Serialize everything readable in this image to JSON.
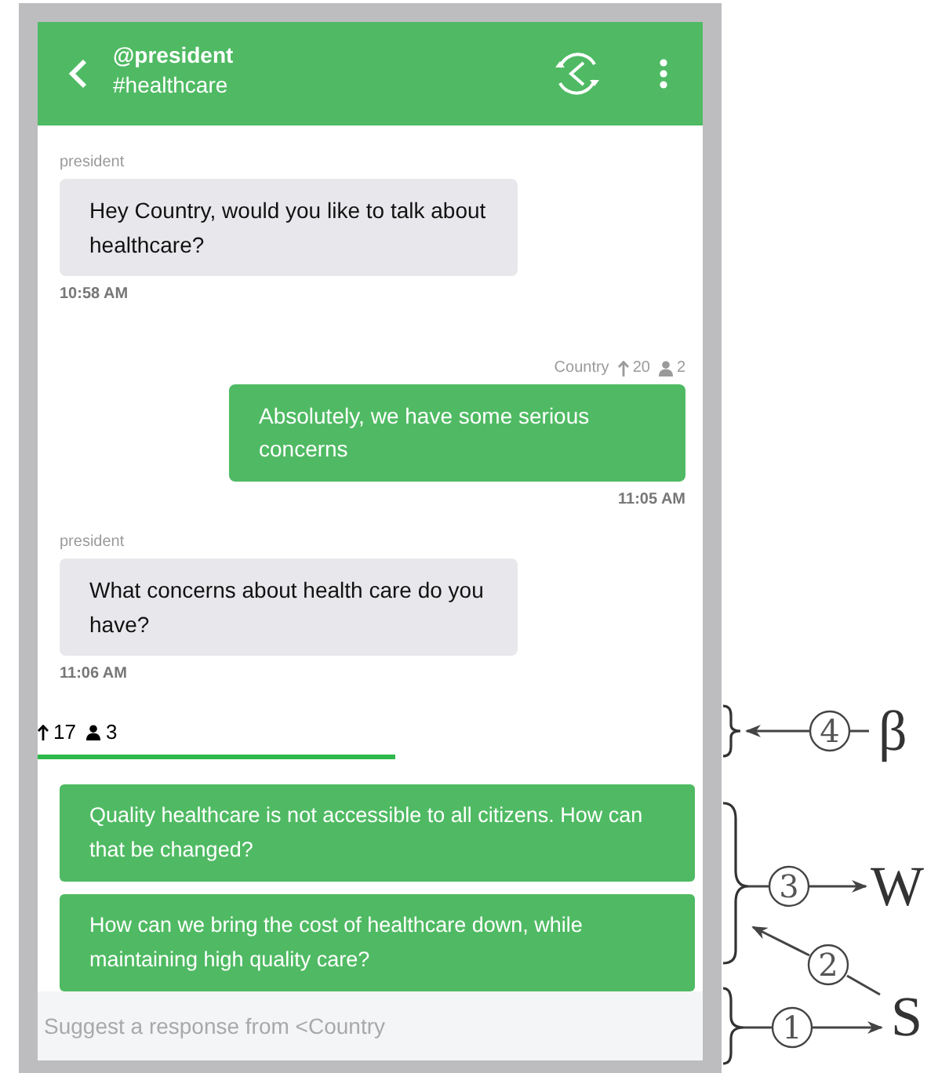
{
  "header": {
    "title": "@president",
    "subtitle": "#healthcare"
  },
  "messages": [
    {
      "kind": "incoming",
      "sender": "president",
      "text": "Hey Country, would you like to talk about healthcare?",
      "time": "10:58 AM"
    },
    {
      "kind": "outgoing",
      "sender": "Country",
      "upvotes": "20",
      "people": "2",
      "text": "Absolutely, we have some serious concerns",
      "time": "11:05 AM"
    },
    {
      "kind": "incoming",
      "sender": "president",
      "text": "What concerns about health care do you have?",
      "time": "11:06 AM"
    }
  ],
  "vote_bar": {
    "upvotes": "17",
    "people": "3"
  },
  "suggestions": [
    "Quality healthcare is not accessible to all citizens. How can that be changed?",
    "How can we bring the cost of healthcare down, while maintaining high quality care?"
  ],
  "input": {
    "placeholder": "Suggest a response from <Country"
  },
  "annotations": [
    {
      "number": "4",
      "symbol": "β"
    },
    {
      "number": "3",
      "symbol": "W"
    },
    {
      "number": "2"
    },
    {
      "number": "1",
      "symbol": "S"
    }
  ]
}
